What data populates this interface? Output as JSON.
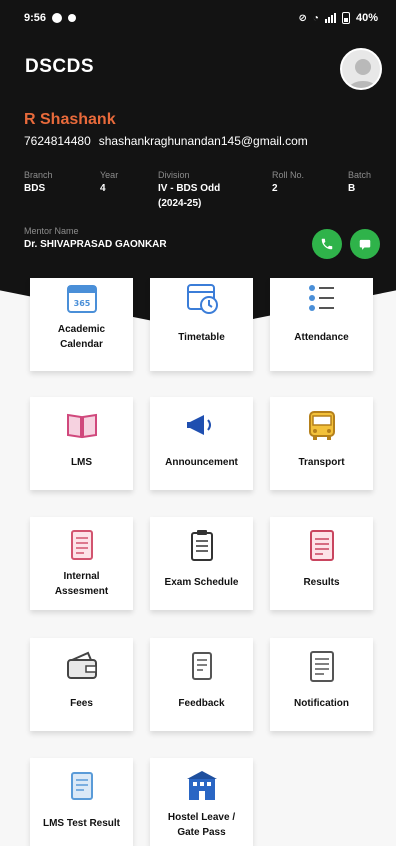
{
  "status_bar": {
    "time": "9:56",
    "battery": "40%"
  },
  "app": {
    "title": "DSCDS"
  },
  "student": {
    "name": "R Shashank",
    "phone": "7624814480",
    "email": "shashankraghunandan145@gmail.com",
    "branch_label": "Branch",
    "branch": "BDS",
    "year_label": "Year",
    "year": "4",
    "division_label": "Division",
    "division_line1": "IV - BDS Odd",
    "division_line2": "(2024-25)",
    "roll_label": "Roll No.",
    "roll": "2",
    "batch_label": "Batch",
    "batch": "B",
    "mentor_label": "Mentor Name",
    "mentor": "Dr. SHIVAPRASAD GAONKAR"
  },
  "tiles": {
    "academic_calendar": {
      "line1": "Academic",
      "line2": "Calendar",
      "icon_text": "365"
    },
    "timetable": "Timetable",
    "attendance": "Attendance",
    "lms": "LMS",
    "announcement": "Announcement",
    "transport": "Transport",
    "internal_assessment": {
      "line1": "Internal",
      "line2": "Assesment"
    },
    "exam_schedule": "Exam Schedule",
    "results": "Results",
    "fees": "Fees",
    "feedback": "Feedback",
    "notification": "Notification",
    "lms_test_result": "LMS Test Result",
    "hostel_leave": {
      "line1": "Hostel Leave /",
      "line2": "Gate Pass"
    }
  },
  "colors": {
    "header_bg": "#131313",
    "name_accent": "#e86a3b",
    "action_green": "#2fb34a"
  }
}
